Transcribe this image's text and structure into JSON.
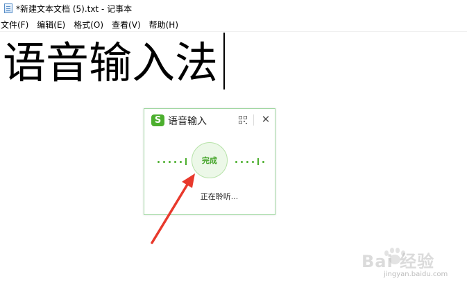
{
  "window": {
    "title": "*新建文本文档 (5).txt - 记事本"
  },
  "menu": {
    "items": [
      "文件(F)",
      "编辑(E)",
      "格式(O)",
      "查看(V)",
      "帮助(H)"
    ]
  },
  "editor": {
    "content": "语音输入法"
  },
  "voice_popup": {
    "logo": "S",
    "title": "语音输入",
    "close": "✕",
    "done_label": "完成",
    "status": "正在聆听...",
    "accent_color": "#4caf2e"
  },
  "annotation": {
    "arrow_color": "#e8392c"
  },
  "watermark": {
    "text": "Bai 经验",
    "url": "jingyan.baidu.com"
  }
}
